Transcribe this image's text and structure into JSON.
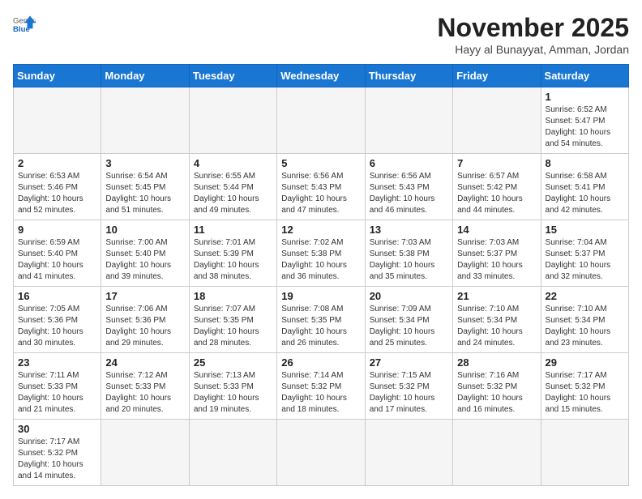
{
  "header": {
    "logo_general": "General",
    "logo_blue": "Blue",
    "month_title": "November 2025",
    "location": "Hayy al Bunayyat, Amman, Jordan"
  },
  "days_of_week": [
    "Sunday",
    "Monday",
    "Tuesday",
    "Wednesday",
    "Thursday",
    "Friday",
    "Saturday"
  ],
  "weeks": [
    [
      {
        "day": "",
        "info": ""
      },
      {
        "day": "",
        "info": ""
      },
      {
        "day": "",
        "info": ""
      },
      {
        "day": "",
        "info": ""
      },
      {
        "day": "",
        "info": ""
      },
      {
        "day": "",
        "info": ""
      },
      {
        "day": "1",
        "info": "Sunrise: 6:52 AM\nSunset: 5:47 PM\nDaylight: 10 hours\nand 54 minutes."
      }
    ],
    [
      {
        "day": "2",
        "info": "Sunrise: 6:53 AM\nSunset: 5:46 PM\nDaylight: 10 hours\nand 52 minutes."
      },
      {
        "day": "3",
        "info": "Sunrise: 6:54 AM\nSunset: 5:45 PM\nDaylight: 10 hours\nand 51 minutes."
      },
      {
        "day": "4",
        "info": "Sunrise: 6:55 AM\nSunset: 5:44 PM\nDaylight: 10 hours\nand 49 minutes."
      },
      {
        "day": "5",
        "info": "Sunrise: 6:56 AM\nSunset: 5:43 PM\nDaylight: 10 hours\nand 47 minutes."
      },
      {
        "day": "6",
        "info": "Sunrise: 6:56 AM\nSunset: 5:43 PM\nDaylight: 10 hours\nand 46 minutes."
      },
      {
        "day": "7",
        "info": "Sunrise: 6:57 AM\nSunset: 5:42 PM\nDaylight: 10 hours\nand 44 minutes."
      },
      {
        "day": "8",
        "info": "Sunrise: 6:58 AM\nSunset: 5:41 PM\nDaylight: 10 hours\nand 42 minutes."
      }
    ],
    [
      {
        "day": "9",
        "info": "Sunrise: 6:59 AM\nSunset: 5:40 PM\nDaylight: 10 hours\nand 41 minutes."
      },
      {
        "day": "10",
        "info": "Sunrise: 7:00 AM\nSunset: 5:40 PM\nDaylight: 10 hours\nand 39 minutes."
      },
      {
        "day": "11",
        "info": "Sunrise: 7:01 AM\nSunset: 5:39 PM\nDaylight: 10 hours\nand 38 minutes."
      },
      {
        "day": "12",
        "info": "Sunrise: 7:02 AM\nSunset: 5:38 PM\nDaylight: 10 hours\nand 36 minutes."
      },
      {
        "day": "13",
        "info": "Sunrise: 7:03 AM\nSunset: 5:38 PM\nDaylight: 10 hours\nand 35 minutes."
      },
      {
        "day": "14",
        "info": "Sunrise: 7:03 AM\nSunset: 5:37 PM\nDaylight: 10 hours\nand 33 minutes."
      },
      {
        "day": "15",
        "info": "Sunrise: 7:04 AM\nSunset: 5:37 PM\nDaylight: 10 hours\nand 32 minutes."
      }
    ],
    [
      {
        "day": "16",
        "info": "Sunrise: 7:05 AM\nSunset: 5:36 PM\nDaylight: 10 hours\nand 30 minutes."
      },
      {
        "day": "17",
        "info": "Sunrise: 7:06 AM\nSunset: 5:36 PM\nDaylight: 10 hours\nand 29 minutes."
      },
      {
        "day": "18",
        "info": "Sunrise: 7:07 AM\nSunset: 5:35 PM\nDaylight: 10 hours\nand 28 minutes."
      },
      {
        "day": "19",
        "info": "Sunrise: 7:08 AM\nSunset: 5:35 PM\nDaylight: 10 hours\nand 26 minutes."
      },
      {
        "day": "20",
        "info": "Sunrise: 7:09 AM\nSunset: 5:34 PM\nDaylight: 10 hours\nand 25 minutes."
      },
      {
        "day": "21",
        "info": "Sunrise: 7:10 AM\nSunset: 5:34 PM\nDaylight: 10 hours\nand 24 minutes."
      },
      {
        "day": "22",
        "info": "Sunrise: 7:10 AM\nSunset: 5:34 PM\nDaylight: 10 hours\nand 23 minutes."
      }
    ],
    [
      {
        "day": "23",
        "info": "Sunrise: 7:11 AM\nSunset: 5:33 PM\nDaylight: 10 hours\nand 21 minutes."
      },
      {
        "day": "24",
        "info": "Sunrise: 7:12 AM\nSunset: 5:33 PM\nDaylight: 10 hours\nand 20 minutes."
      },
      {
        "day": "25",
        "info": "Sunrise: 7:13 AM\nSunset: 5:33 PM\nDaylight: 10 hours\nand 19 minutes."
      },
      {
        "day": "26",
        "info": "Sunrise: 7:14 AM\nSunset: 5:32 PM\nDaylight: 10 hours\nand 18 minutes."
      },
      {
        "day": "27",
        "info": "Sunrise: 7:15 AM\nSunset: 5:32 PM\nDaylight: 10 hours\nand 17 minutes."
      },
      {
        "day": "28",
        "info": "Sunrise: 7:16 AM\nSunset: 5:32 PM\nDaylight: 10 hours\nand 16 minutes."
      },
      {
        "day": "29",
        "info": "Sunrise: 7:17 AM\nSunset: 5:32 PM\nDaylight: 10 hours\nand 15 minutes."
      }
    ],
    [
      {
        "day": "30",
        "info": "Sunrise: 7:17 AM\nSunset: 5:32 PM\nDaylight: 10 hours\nand 14 minutes."
      },
      {
        "day": "",
        "info": ""
      },
      {
        "day": "",
        "info": ""
      },
      {
        "day": "",
        "info": ""
      },
      {
        "day": "",
        "info": ""
      },
      {
        "day": "",
        "info": ""
      },
      {
        "day": "",
        "info": ""
      }
    ]
  ]
}
